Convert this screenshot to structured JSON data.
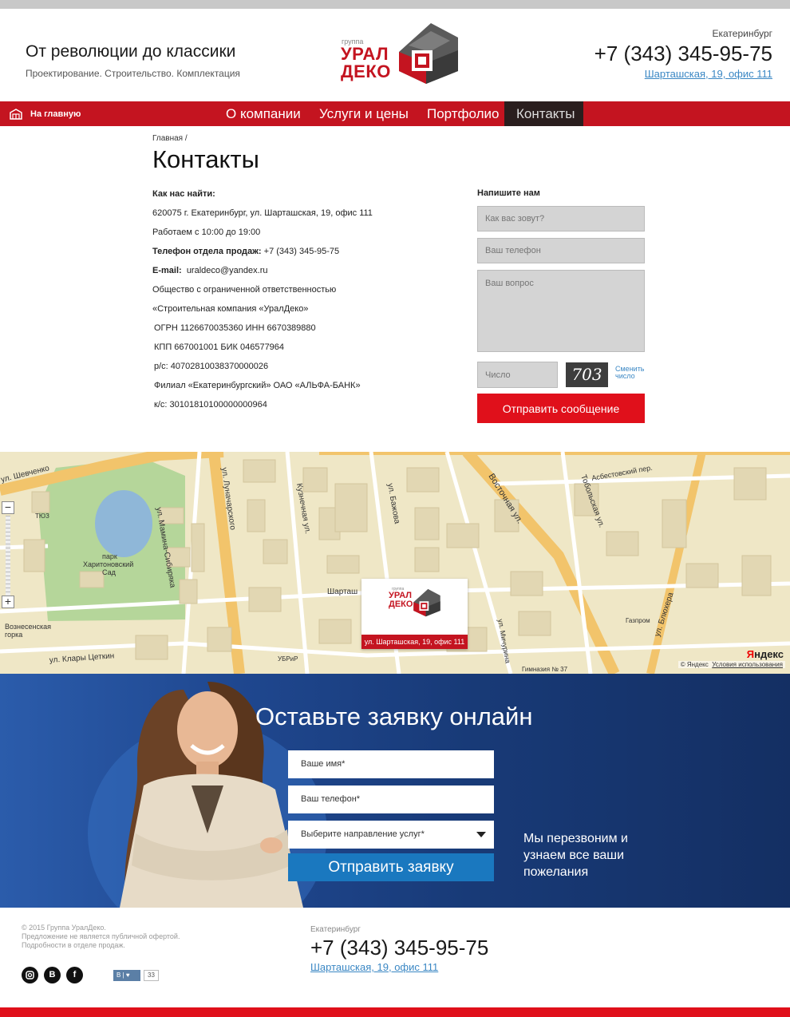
{
  "header": {
    "slogan": "От революции до классики",
    "slogan_sub": "Проектирование. Строительство. Комплектация",
    "logo": {
      "small": "группа",
      "line1": "УРАЛ",
      "line2": "ДЕКО"
    },
    "city": "Екатеринбург",
    "phone": "+7 (343) 345-95-75",
    "address": "Шарташская, 19, офис 111"
  },
  "nav": {
    "home": "На главную",
    "items": [
      "О компании",
      "Услуги и цены",
      "Портфолио",
      "Контакты"
    ],
    "active": "Контакты"
  },
  "page": {
    "breadcrumb": "Главная /",
    "title": "Контакты"
  },
  "contacts": {
    "heading": "Как нас найти:",
    "address_line": "620075 г. Екатеринбург, ул. Шарташская, 19, офис 111",
    "hours": "Работаем с 10:00 до 19:00",
    "sales_label": "Телефон отдела продаж:",
    "sales_phone": "+7 (343) 345-95-75",
    "email_label": "E-mail:",
    "email": "uraldeco@yandex.ru",
    "org1": "Общество с ограниченной ответственностью",
    "org2": "«Строительная компания «УралДеко»",
    "ogrn": "ОГРН 1126670035360 ИНН 6670389880",
    "kpp": "КПП 667001001 БИК 046577964",
    "rs": "р/с: 40702810038370000026",
    "branch": "Филиал «Екатеринбургский» ОАО «АЛЬФА-БАНК»",
    "ks": "к/с: 30101810100000000964"
  },
  "message_form": {
    "title": "Напишите нам",
    "name_placeholder": "Как вас зовут?",
    "phone_placeholder": "Ваш телефон",
    "question_placeholder": "Ваш вопрос",
    "captcha_placeholder": "Число",
    "captcha_value": "703",
    "captcha_refresh": "Сменить число",
    "submit": "Отправить сообщение"
  },
  "map": {
    "labels": {
      "shevchenko": "ул. Шевченко",
      "tyuz": "ТЮЗ",
      "park1": "парк",
      "park2": "Харитоновский",
      "park3": "Сад",
      "mamina": "ул. Мамина-Сибиряка",
      "lunacharskogo": "ул. Луначарского",
      "kuznechnaya": "Кузнечная ул.",
      "bazhova": "ул. Бажова",
      "vostochnaya": "Восточная ул.",
      "tobolskaya": "Тобольская ул.",
      "asbestovsky": "Асбестовский пер.",
      "blyuhera": "ул. Блюхера",
      "sharts": "Шарташ",
      "voznes": "Вознесенская",
      "gorka": "горка",
      "klary": "ул. Клары Цеткин",
      "ubrir": "УБРиР",
      "michurina": "ул. Мичурина",
      "gymnasium": "Гимназия № 37",
      "gazprom": "Газпром"
    },
    "callout": {
      "small": "группа",
      "line1": "УРАЛ",
      "line2": "ДЕКО",
      "address": "ул. Шарташская, 19, офис 111"
    },
    "copyright": "© Яндекс",
    "terms": "Условия использования",
    "brand_y": "Я",
    "brand_rest": "ндекс"
  },
  "lead": {
    "title": "Оставьте заявку онлайн",
    "name_placeholder": "Ваше имя*",
    "phone_placeholder": "Ваш телефон*",
    "service_placeholder": "Выберите направление услуг*",
    "submit": "Отправить заявку",
    "note": "Мы перезвоним и узнаем все ваши пожелания"
  },
  "footer": {
    "copy1": "© 2015 Группа УралДеко.",
    "copy2": "Предложение не является публичной офертой.",
    "copy3": "Подробности в отделе продаж.",
    "city": "Екатеринбург",
    "phone": "+7 (343) 345-95-75",
    "address": "Шарташская, 19, офис 111",
    "vk_like_count": "33"
  },
  "colors": {
    "brand_red": "#c41420",
    "button_red": "#e0101b",
    "link_blue": "#3a87c4",
    "lead_blue": "#1f478f",
    "lead_button": "#1a78bf"
  },
  "icons": [
    "home-icon",
    "instagram-icon",
    "vk-icon",
    "facebook-icon",
    "dropdown-caret-icon",
    "zoom-in-icon",
    "zoom-out-icon",
    "logo-mark-icon"
  ]
}
